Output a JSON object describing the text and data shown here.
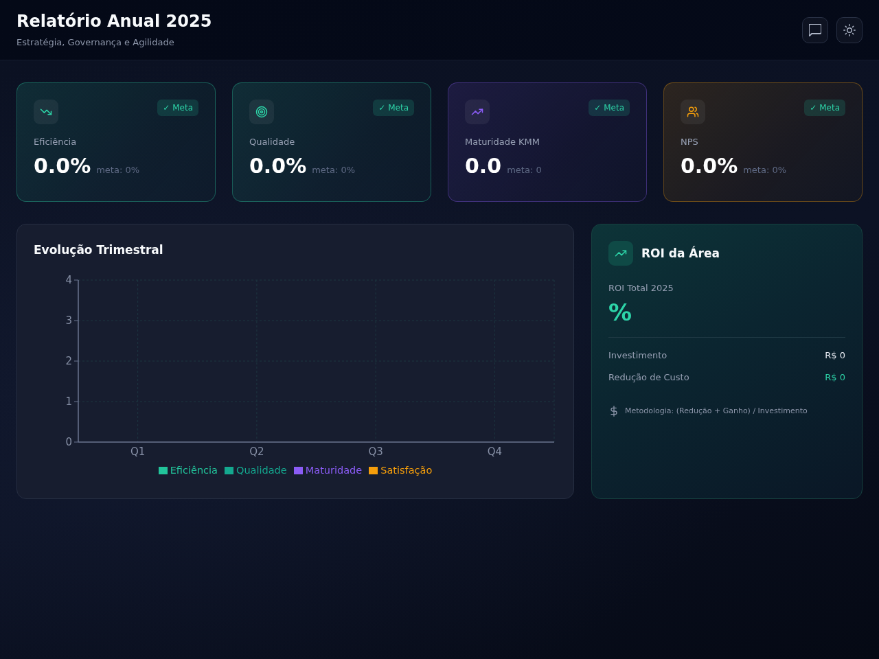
{
  "header": {
    "title": "Relatório Anual 2025",
    "subtitle": "Estratégia, Governança e Agilidade"
  },
  "kpis": [
    {
      "label": "Eficiência",
      "value": "0.0%",
      "target": "meta: 0%",
      "badge": "✓ Meta",
      "color": "#2dd4a8"
    },
    {
      "label": "Qualidade",
      "value": "0.0%",
      "target": "meta: 0%",
      "badge": "✓ Meta",
      "color": "#2dd4a8"
    },
    {
      "label": "Maturidade KMM",
      "value": "0.0",
      "target": "meta: 0",
      "badge": "✓ Meta",
      "color": "#8b5cf6"
    },
    {
      "label": "NPS",
      "value": "0.0%",
      "target": "meta: 0%",
      "badge": "✓ Meta",
      "color": "#f59e0b"
    }
  ],
  "chart_panel": {
    "title": "Evolução Trimestral",
    "chart_data": {
      "type": "bar",
      "categories": [
        "Q1",
        "Q2",
        "Q3",
        "Q4"
      ],
      "series": [
        {
          "name": "Eficiência",
          "color": "#22c49b",
          "values": [
            0,
            0,
            0,
            0
          ]
        },
        {
          "name": "Qualidade",
          "color": "#14a88f",
          "values": [
            0,
            0,
            0,
            0
          ]
        },
        {
          "name": "Maturidade",
          "color": "#8b5cf6",
          "values": [
            0,
            0,
            0,
            0
          ]
        },
        {
          "name": "Satisfação",
          "color": "#f59e0b",
          "values": [
            0,
            0,
            0,
            0
          ]
        }
      ],
      "ylim": [
        0,
        4
      ],
      "yticks": [
        0,
        1,
        2,
        3,
        4
      ],
      "grid": true,
      "legend": "bottom"
    }
  },
  "roi_panel": {
    "title": "ROI da Área",
    "total_label": "ROI Total 2025",
    "total_value": "%",
    "rows": [
      {
        "label": "Investimento",
        "value": "R$ 0",
        "kind": "plain"
      },
      {
        "label": "Redução de Custo",
        "value": "R$ 0",
        "kind": "gain"
      }
    ],
    "note": "Metodologia: (Redução + Ganho) / Investimento"
  }
}
